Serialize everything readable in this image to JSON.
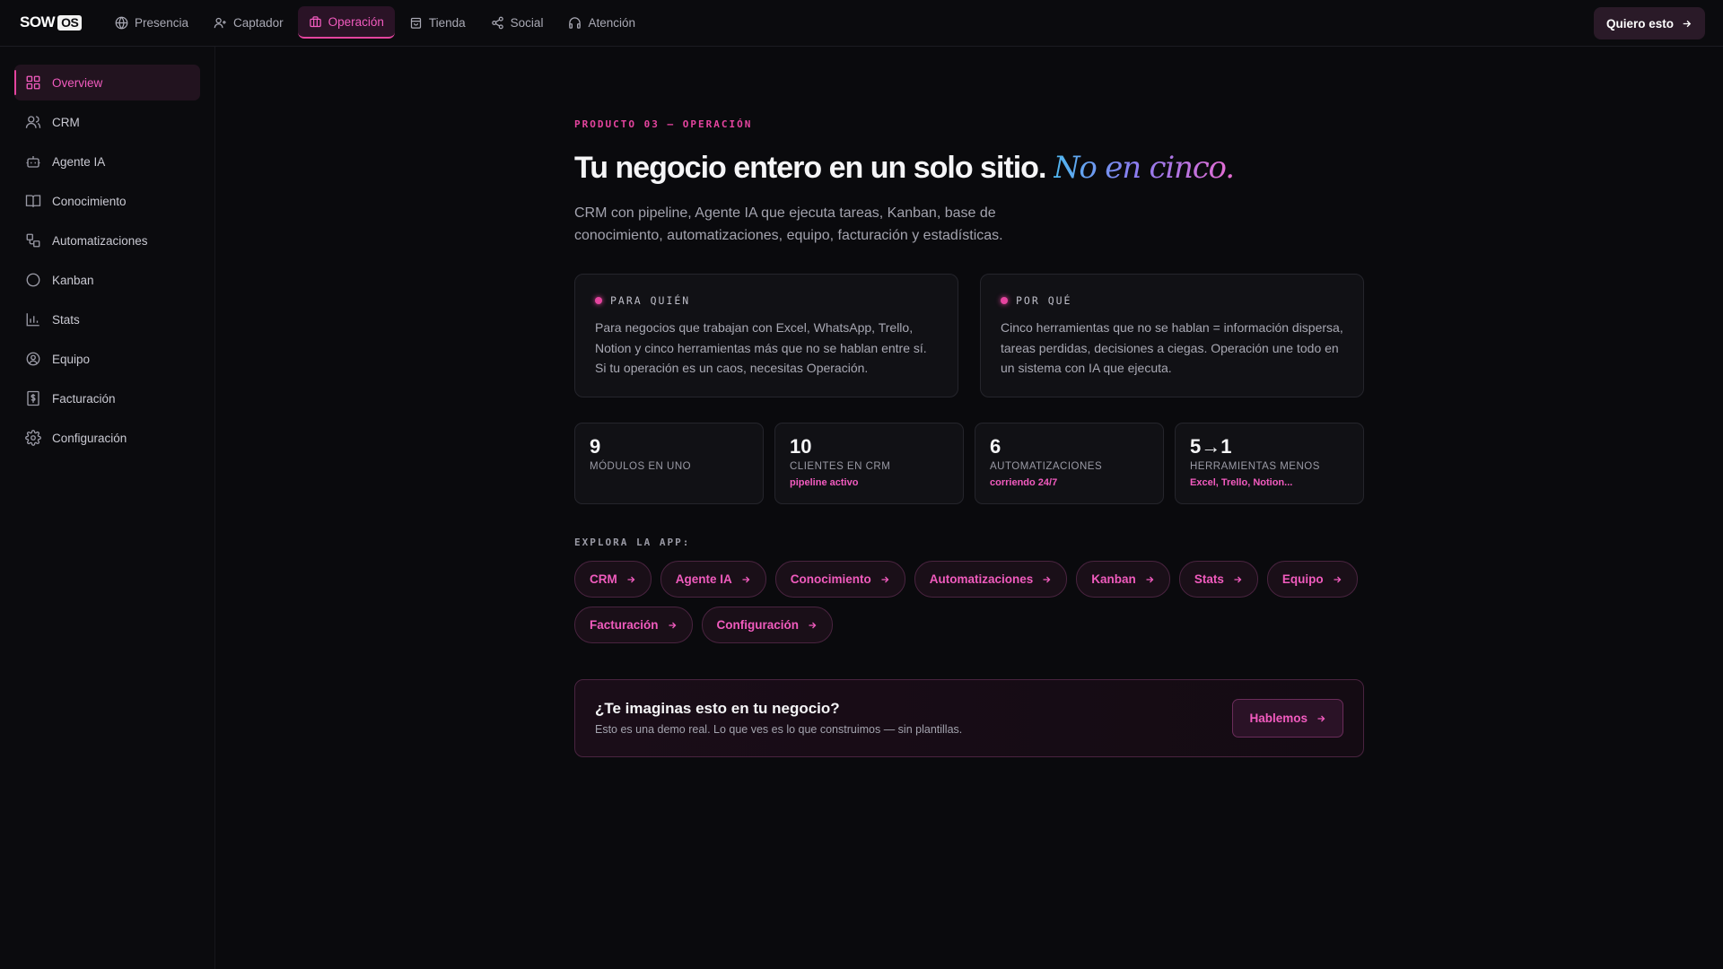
{
  "brand": {
    "logo_text": "SOW",
    "logo_badge": "OS"
  },
  "topnav": {
    "items": [
      {
        "label": "Presencia",
        "icon": "globe-icon"
      },
      {
        "label": "Captador",
        "icon": "user-plus-icon"
      },
      {
        "label": "Operación",
        "icon": "briefcase-icon",
        "active": true
      },
      {
        "label": "Tienda",
        "icon": "shopping-bag-icon"
      },
      {
        "label": "Social",
        "icon": "share-icon"
      },
      {
        "label": "Atención",
        "icon": "headphones-icon"
      }
    ],
    "cta_label": "Quiero esto"
  },
  "sidebar": {
    "items": [
      {
        "label": "Overview",
        "icon": "grid-icon",
        "active": true
      },
      {
        "label": "CRM",
        "icon": "users-icon"
      },
      {
        "label": "Agente IA",
        "icon": "bot-icon"
      },
      {
        "label": "Conocimiento",
        "icon": "book-icon"
      },
      {
        "label": "Automatizaciones",
        "icon": "workflow-icon"
      },
      {
        "label": "Kanban",
        "icon": "circle-icon"
      },
      {
        "label": "Stats",
        "icon": "bar-chart-icon"
      },
      {
        "label": "Equipo",
        "icon": "user-circle-icon"
      },
      {
        "label": "Facturación",
        "icon": "receipt-icon"
      },
      {
        "label": "Configuración",
        "icon": "gear-icon"
      }
    ]
  },
  "hero": {
    "eyebrow": "PRODUCTO 03 — OPERACIÓN",
    "title": "Tu negocio entero en un solo sitio.",
    "title_accent": "No en cinco.",
    "lead": "CRM con pipeline, Agente IA que ejecuta tareas, Kanban, base de conocimiento, automatizaciones, equipo, facturación y estadísticas."
  },
  "cards": [
    {
      "title": "PARA QUIÉN",
      "body": "Para negocios que trabajan con Excel, WhatsApp, Trello, Notion y cinco herramientas más que no se hablan entre sí. Si tu operación es un caos, necesitas Operación."
    },
    {
      "title": "POR QUÉ",
      "body": "Cinco herramientas que no se hablan = información dispersa, tareas perdidas, decisiones a ciegas. Operación une todo en un sistema con IA que ejecuta."
    }
  ],
  "stats": [
    {
      "value": "9",
      "label": "MÓDULOS EN UNO",
      "sub": ""
    },
    {
      "value": "10",
      "label": "CLIENTES EN CRM",
      "sub": "pipeline activo"
    },
    {
      "value": "6",
      "label": "AUTOMATIZACIONES",
      "sub": "corriendo 24/7"
    },
    {
      "value": "5→1",
      "label": "HERRAMIENTAS MENOS",
      "sub": "Excel, Trello, Notion..."
    }
  ],
  "explore": {
    "label": "EXPLORA LA APP:",
    "chips": [
      "CRM",
      "Agente IA",
      "Conocimiento",
      "Automatizaciones",
      "Kanban",
      "Stats",
      "Equipo",
      "Facturación",
      "Configuración"
    ]
  },
  "cta": {
    "title": "¿Te imaginas esto en tu negocio?",
    "subtitle": "Esto es una demo real. Lo que ves es lo que construimos — sin plantillas.",
    "button": "Hablemos"
  },
  "colors": {
    "accent": "#e5449f",
    "background": "#0a0a0d",
    "card": "#111115"
  }
}
